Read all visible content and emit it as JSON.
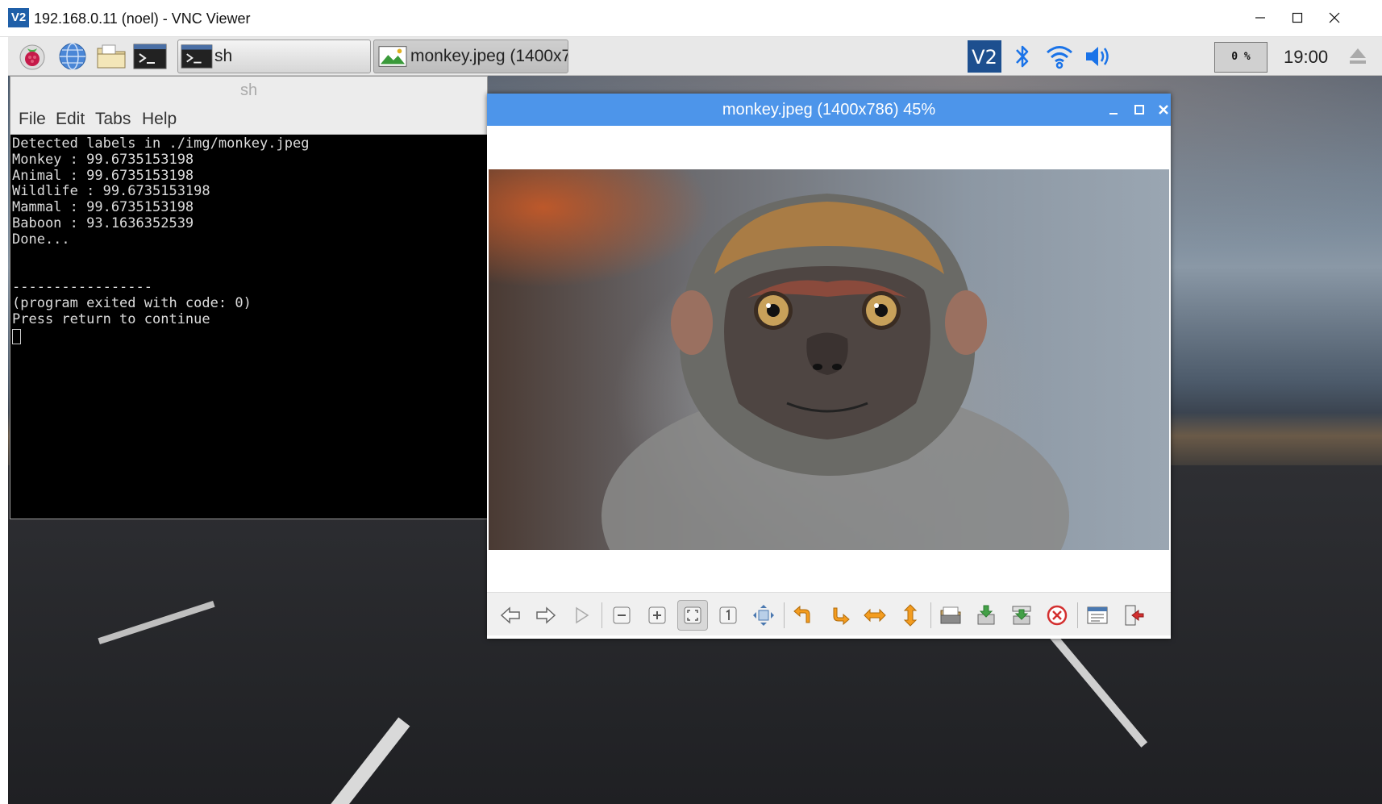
{
  "vnc": {
    "logo": "V2",
    "title": "192.168.0.11 (noel) - VNC Viewer",
    "controls": [
      "minimize-icon",
      "maximize-icon",
      "close-icon"
    ]
  },
  "panel": {
    "launchers": [
      "raspberry-menu-icon",
      "web-browser-icon",
      "file-manager-icon",
      "terminal-icon"
    ],
    "tasks": [
      {
        "label": "sh",
        "icon": "terminal-icon"
      },
      {
        "label": "monkey.jpeg (1400x7…",
        "icon": "image-viewer-icon"
      }
    ],
    "tray": [
      "vnc-server-icon",
      "bluetooth-icon",
      "wifi-icon",
      "volume-icon"
    ],
    "cpu": "0 %",
    "clock": "19:00",
    "eject_icon": "eject-icon"
  },
  "terminal": {
    "title": "sh",
    "menu": [
      "File",
      "Edit",
      "Tabs",
      "Help"
    ],
    "lines": [
      "Detected labels in ./img/monkey.jpeg",
      "Monkey : 99.6735153198",
      "Animal : 99.6735153198",
      "Wildlife : 99.6735153198",
      "Mammal : 99.6735153198",
      "Baboon : 93.1636352539",
      "Done...",
      "",
      "",
      "-----------------",
      "(program exited with code: 0)",
      "Press return to continue"
    ]
  },
  "viewer": {
    "title": "monkey.jpeg (1400x786) 45%",
    "image_subject": "monkey",
    "toolbar": [
      "previous-icon",
      "next-icon",
      "slideshow-icon",
      "zoom-out-icon",
      "zoom-in-icon",
      "fit-window-icon",
      "original-size-icon",
      "fullscreen-icon",
      "rotate-left-icon",
      "rotate-right-icon",
      "flip-horizontal-icon",
      "flip-vertical-icon",
      "open-file-icon",
      "save-file-icon",
      "save-as-icon",
      "delete-icon",
      "preferences-icon",
      "quit-icon"
    ]
  }
}
